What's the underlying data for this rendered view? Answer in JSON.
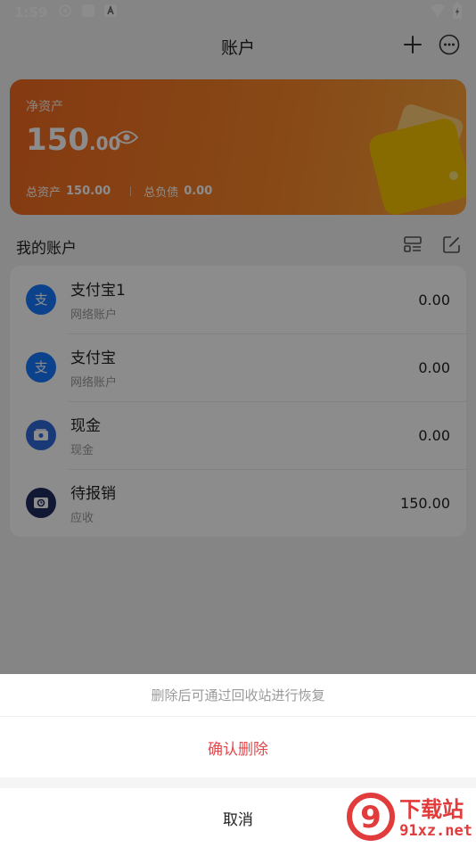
{
  "status_bar": {
    "time": "1:59",
    "icons": [
      "sync-icon",
      "square-icon",
      "a-icon",
      "wifi-icon",
      "battery-icon"
    ]
  },
  "header": {
    "title": "账户",
    "actions": [
      "plus-icon",
      "more-icon"
    ]
  },
  "asset_card": {
    "net_label": "净资产",
    "net_int": "150",
    "net_dec": ".00",
    "total_assets_label": "总资产",
    "total_assets": "150.00",
    "total_liab_label": "总负债",
    "total_liab": "0.00",
    "gradient_colors": [
      "#f2691f",
      "#fba33a"
    ]
  },
  "section": {
    "title": "我的账户"
  },
  "accounts": [
    {
      "name": "支付宝1",
      "type": "网络账户",
      "amount": "0.00",
      "icon": "alipay-icon"
    },
    {
      "name": "支付宝",
      "type": "网络账户",
      "amount": "0.00",
      "icon": "alipay-icon"
    },
    {
      "name": "现金",
      "type": "现金",
      "amount": "0.00",
      "icon": "cash-icon"
    },
    {
      "name": "待报销",
      "type": "应收",
      "amount": "150.00",
      "icon": "reimburse-icon"
    }
  ],
  "action_sheet": {
    "hint": "删除后可通过回收站进行恢复",
    "confirm": "确认删除",
    "cancel": "取消",
    "confirm_color": "#e5484d"
  },
  "watermark": {
    "cn": "下载站",
    "en": "91xz.net",
    "logo_text": "9"
  }
}
